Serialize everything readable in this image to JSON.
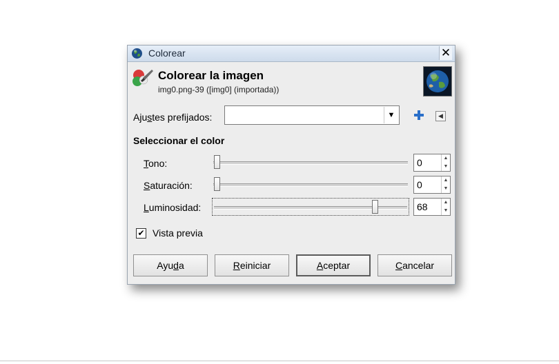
{
  "window": {
    "title": "Colorear",
    "close_glyph": "✕"
  },
  "header": {
    "title": "Colorear la imagen",
    "subtitle": "img0.png-39 ([img0] (importada))"
  },
  "presets": {
    "label_pre": "Aju",
    "label_mnemonic": "s",
    "label_post": "tes prefijados:",
    "value": ""
  },
  "section": {
    "title": "Seleccionar el color"
  },
  "sliders": [
    {
      "mnemonic": "T",
      "rest": "ono:",
      "value": "0",
      "fraction": 0
    },
    {
      "mnemonic": "S",
      "rest": "aturación:",
      "value": "0",
      "fraction": 0
    },
    {
      "mnemonic": "L",
      "rest": "uminosidad:",
      "value": "68",
      "fraction": 0.84
    }
  ],
  "preview": {
    "label": "Vista previa",
    "checked": true,
    "check_glyph": "✔"
  },
  "buttons": {
    "help_pre": "Ayu",
    "help_mnemonic": "d",
    "help_post": "a",
    "reset_mnemonic": "R",
    "reset_post": "einiciar",
    "ok_mnemonic": "A",
    "ok_post": "ceptar",
    "cancel_mnemonic": "C",
    "cancel_post": "ancelar"
  },
  "icons": {
    "title": "gimp-globe-icon",
    "header": "colorize-icon",
    "thumbnail": "earth-thumbnail",
    "add": "plus-icon",
    "menu": "triangle-left-icon"
  },
  "colors": {
    "accent": "#2a6fc9"
  }
}
